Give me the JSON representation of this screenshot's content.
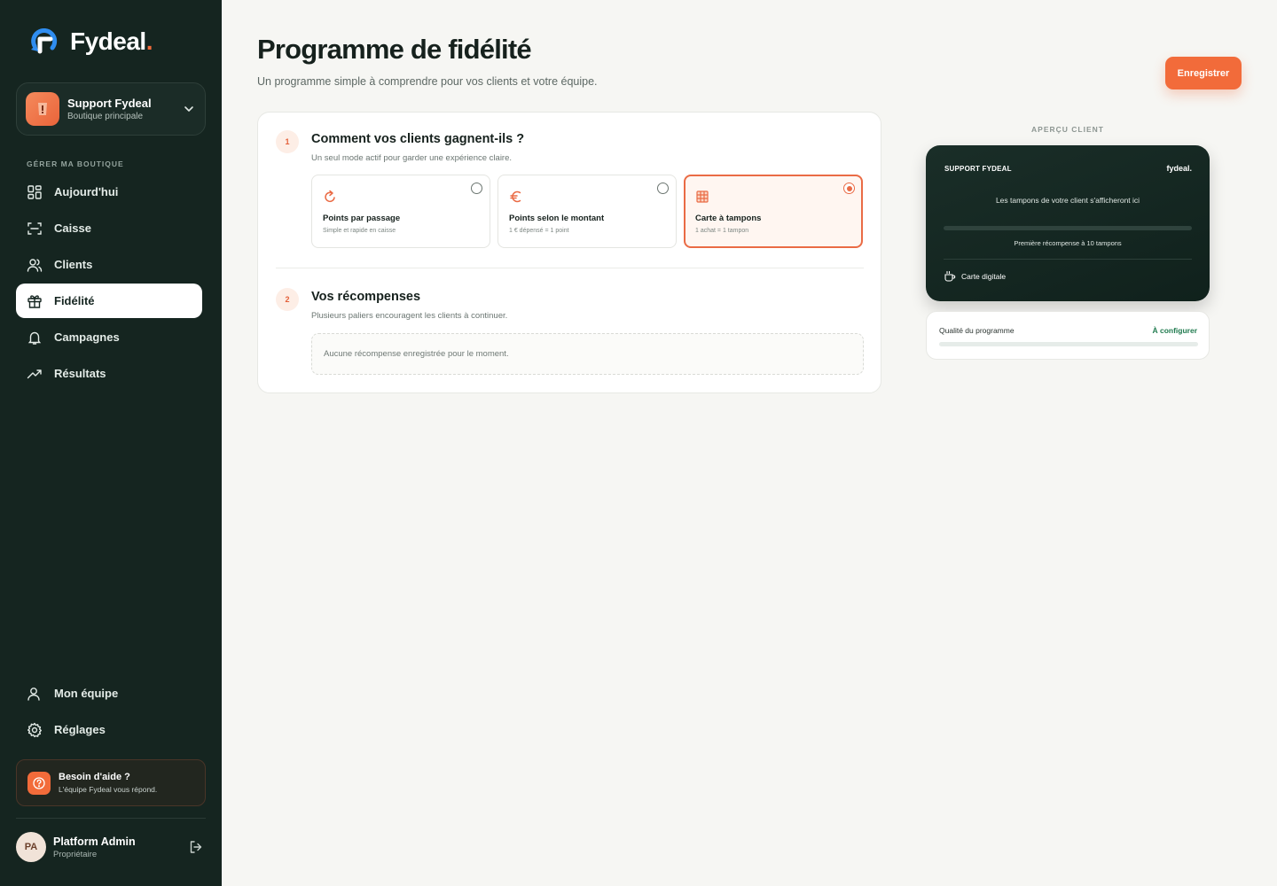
{
  "brand": {
    "name": "Fydeal",
    "dot": "."
  },
  "store": {
    "name": "Support Fydeal",
    "subtitle": "Boutique principale"
  },
  "sidebar": {
    "section_label": "GÉRER MA BOUTIQUE",
    "items": [
      {
        "label": "Aujourd'hui",
        "icon": "dashboard-icon"
      },
      {
        "label": "Caisse",
        "icon": "scan-icon"
      },
      {
        "label": "Clients",
        "icon": "users-icon"
      },
      {
        "label": "Fidélité",
        "icon": "gift-icon",
        "active": true
      },
      {
        "label": "Campagnes",
        "icon": "bell-icon"
      },
      {
        "label": "Résultats",
        "icon": "trending-icon"
      }
    ],
    "bottom_items": [
      {
        "label": "Mon équipe",
        "icon": "user-icon"
      },
      {
        "label": "Réglages",
        "icon": "gear-icon"
      }
    ],
    "help": {
      "title": "Besoin d'aide ?",
      "subtitle": "L'équipe Fydeal vous répond."
    },
    "user": {
      "initials": "PA",
      "name": "Platform Admin",
      "role": "Propriétaire"
    }
  },
  "header": {
    "title": "Programme de fidélité",
    "subtitle": "Un programme simple à comprendre pour vos clients et votre équipe.",
    "save_label": "Enregistrer"
  },
  "step1": {
    "number": "1",
    "title": "Comment vos clients gagnent-ils ?",
    "subtitle": "Un seul mode actif pour garder une expérience claire.",
    "options": [
      {
        "title": "Points par passage",
        "subtitle": "Simple et rapide en caisse",
        "icon": "refresh-icon",
        "selected": false
      },
      {
        "title": "Points selon le montant",
        "subtitle": "1 € dépensé = 1 point",
        "icon": "euro-icon",
        "selected": false
      },
      {
        "title": "Carte à tampons",
        "subtitle": "1 achat = 1 tampon",
        "icon": "stamp-grid-icon",
        "selected": true
      }
    ]
  },
  "step2": {
    "number": "2",
    "title": "Vos récompenses",
    "subtitle": "Plusieurs paliers encouragent les clients à continuer.",
    "empty": "Aucune récompense enregistrée pour le moment."
  },
  "preview": {
    "label": "APERÇU CLIENT",
    "card_brand": "SUPPORT FYDEAL",
    "card_logo": "fydeal.",
    "card_message": "Les tampons de votre client s'afficheront ici",
    "card_reward": "Première récompense à 10 tampons",
    "card_footer": "Carte digitale",
    "quality_label": "Qualité du programme",
    "quality_status": "À configurer",
    "quality_progress": 0
  },
  "colors": {
    "accent": "#f26b3a",
    "sidebar": "#152520",
    "success": "#1f7a4e"
  }
}
